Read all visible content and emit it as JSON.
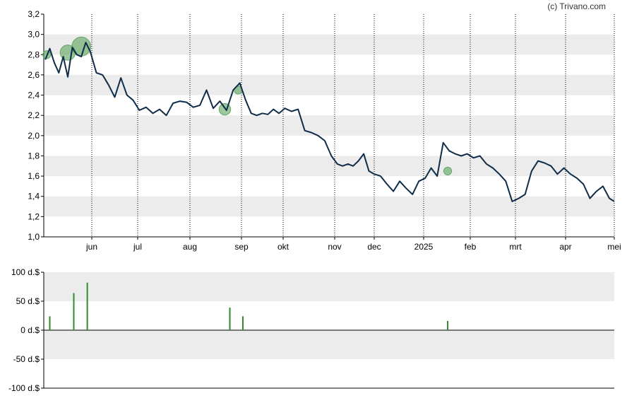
{
  "credit": "(c) Trivano.com",
  "colors": {
    "price_line": "#0f2d4a",
    "band": "#ececec",
    "dividend_bubble": "#5aa35a",
    "volume_bar": "#2e8b2e",
    "axis": "#000000"
  },
  "chart_data": [
    {
      "type": "line",
      "title": "",
      "xlabel": "",
      "ylabel": "",
      "x_tick_labels": [
        "jun",
        "jul",
        "aug",
        "sep",
        "okt",
        "nov",
        "dec",
        "2025",
        "feb",
        "mrt",
        "apr",
        "mei"
      ],
      "y_tick_labels": [
        "1,0",
        "1,2",
        "1,4",
        "1,6",
        "1,8",
        "2,0",
        "2,2",
        "2,4",
        "2,6",
        "2,8",
        "3,0",
        "3,2"
      ],
      "ylim": [
        1.0,
        3.2
      ],
      "grid": "horizontal bands + dotted monthly verticals",
      "series": [
        {
          "x": [
            "2024-05-01",
            "2024-05-04",
            "2024-05-07",
            "2024-05-10",
            "2024-05-13",
            "2024-05-16",
            "2024-05-19",
            "2024-05-22",
            "2024-05-25",
            "2024-05-28",
            "2024-05-31",
            "2024-06-04",
            "2024-06-08",
            "2024-06-12",
            "2024-06-16",
            "2024-06-20",
            "2024-06-24",
            "2024-06-28",
            "2024-07-02",
            "2024-07-06",
            "2024-07-10",
            "2024-07-14",
            "2024-07-18",
            "2024-07-22",
            "2024-07-26",
            "2024-07-30",
            "2024-08-03",
            "2024-08-07",
            "2024-08-11",
            "2024-08-15",
            "2024-08-19",
            "2024-08-23",
            "2024-08-27",
            "2024-08-31",
            "2024-09-04",
            "2024-09-08",
            "2024-09-12",
            "2024-09-16",
            "2024-09-20",
            "2024-09-24",
            "2024-09-28",
            "2024-10-02",
            "2024-10-06",
            "2024-10-10",
            "2024-10-14",
            "2024-10-18",
            "2024-10-22",
            "2024-10-26",
            "2024-10-30",
            "2024-11-03",
            "2024-11-07",
            "2024-11-11",
            "2024-11-15",
            "2024-11-19",
            "2024-11-23",
            "2024-11-27",
            "2024-12-01",
            "2024-12-05",
            "2024-12-09",
            "2024-12-13",
            "2024-12-17",
            "2024-12-21",
            "2024-12-25",
            "2024-12-29",
            "2025-01-02",
            "2025-01-06",
            "2025-01-10",
            "2025-01-14",
            "2025-01-18",
            "2025-01-22",
            "2025-01-26",
            "2025-01-30",
            "2025-02-03",
            "2025-02-07",
            "2025-02-11",
            "2025-02-15",
            "2025-02-19",
            "2025-02-23",
            "2025-02-27",
            "2025-03-03",
            "2025-03-07",
            "2025-03-11",
            "2025-03-15",
            "2025-03-19",
            "2025-03-23",
            "2025-03-27",
            "2025-03-31",
            "2025-04-04",
            "2025-04-08",
            "2025-04-12",
            "2025-04-16",
            "2025-04-20",
            "2025-04-24",
            "2025-04-28",
            "2025-05-01"
          ],
          "values": [
            2.75,
            2.86,
            2.72,
            2.62,
            2.78,
            2.58,
            2.87,
            2.8,
            2.78,
            2.92,
            2.83,
            2.62,
            2.6,
            2.5,
            2.38,
            2.57,
            2.4,
            2.35,
            2.25,
            2.28,
            2.22,
            2.26,
            2.2,
            2.32,
            2.34,
            2.33,
            2.28,
            2.3,
            2.45,
            2.27,
            2.34,
            2.25,
            2.45,
            2.52,
            2.35,
            2.22,
            2.2,
            2.22,
            2.21,
            2.26,
            2.22,
            2.27,
            2.24,
            2.26,
            2.05,
            2.03,
            2.0,
            1.95,
            1.8,
            1.72,
            1.7,
            1.72,
            1.7,
            1.75,
            1.82,
            1.65,
            1.62,
            1.6,
            1.52,
            1.45,
            1.55,
            1.48,
            1.42,
            1.55,
            1.58,
            1.68,
            1.6,
            1.93,
            1.85,
            1.82,
            1.8,
            1.82,
            1.78,
            1.8,
            1.72,
            1.68,
            1.62,
            1.55,
            1.35,
            1.38,
            1.42,
            1.65,
            1.75,
            1.73,
            1.7,
            1.62,
            1.68,
            1.62,
            1.58,
            1.52,
            1.38,
            1.45,
            1.5,
            1.38,
            1.35
          ]
        }
      ],
      "dividend_markers": [
        {
          "x": "2024-05-02",
          "value": 2.8,
          "size": 1
        },
        {
          "x": "2024-05-16",
          "value": 2.82,
          "size": 3
        },
        {
          "x": "2024-05-25",
          "value": 2.88,
          "size": 4
        },
        {
          "x": "2024-08-22",
          "value": 2.26,
          "size": 2
        },
        {
          "x": "2024-08-30",
          "value": 2.45,
          "size": 1
        },
        {
          "x": "2025-01-17",
          "value": 1.65,
          "size": 1
        }
      ]
    },
    {
      "type": "bar",
      "title": "",
      "y_tick_labels": [
        "100 d.$",
        "50 d.$",
        "0 d.$",
        "-50 d.$",
        "-100 d.$"
      ],
      "ylim": [
        -100,
        100
      ],
      "x": [
        "2024-05-04",
        "2024-05-20",
        "2024-05-29",
        "2024-08-25",
        "2024-09-02",
        "2025-01-17"
      ],
      "values": [
        24,
        64,
        82,
        39,
        24,
        16
      ]
    }
  ]
}
